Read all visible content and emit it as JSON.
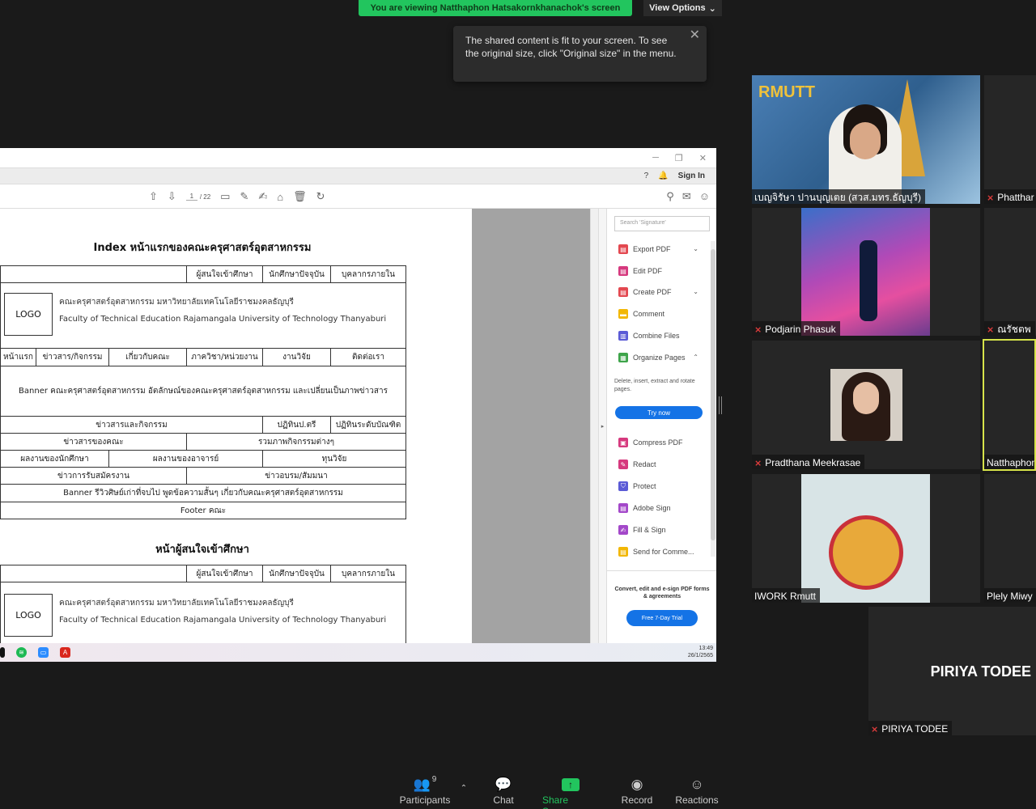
{
  "banner": {
    "viewing_text": "You are viewing Natthaphon Hatsakornkhanachok's screen",
    "view_options": "View Options"
  },
  "tooltip": {
    "text": "The shared content is fit to your screen. To see the original size, click \"Original size\" in the menu."
  },
  "acrobat": {
    "sign_in": "Sign In",
    "page_current": "1",
    "page_total": "/ 22",
    "search_placeholder": "Search 'Signature'",
    "tools": [
      {
        "label": "Export PDF",
        "color": "#e34850",
        "icon": "export-pdf-icon",
        "chevron": "⌄"
      },
      {
        "label": "Edit PDF",
        "color": "#d6397e",
        "icon": "edit-pdf-icon",
        "chevron": ""
      },
      {
        "label": "Create PDF",
        "color": "#e34850",
        "icon": "create-pdf-icon",
        "chevron": "⌄"
      },
      {
        "label": "Comment",
        "color": "#f2b705",
        "icon": "comment-icon",
        "chevron": ""
      },
      {
        "label": "Combine Files",
        "color": "#5b5bd6",
        "icon": "combine-files-icon",
        "chevron": ""
      },
      {
        "label": "Organize Pages",
        "color": "#3ea44a",
        "icon": "organize-pages-icon",
        "chevron": "⌃"
      }
    ],
    "organize_note": "Delete, insert, extract and rotate pages.",
    "try_now": "Try now",
    "tools2": [
      {
        "label": "Compress PDF",
        "color": "#d6397e",
        "icon": "compress-pdf-icon"
      },
      {
        "label": "Redact",
        "color": "#d6397e",
        "icon": "redact-icon"
      },
      {
        "label": "Protect",
        "color": "#5b5bd6",
        "icon": "protect-icon"
      },
      {
        "label": "Adobe Sign",
        "color": "#a348c9",
        "icon": "adobe-sign-icon"
      },
      {
        "label": "Fill & Sign",
        "color": "#a348c9",
        "icon": "fill-sign-icon"
      },
      {
        "label": "Send for Comme...",
        "color": "#f2b705",
        "icon": "send-comment-icon"
      }
    ],
    "promo_text": "Convert, edit and e-sign PDF forms & agreements",
    "free_trial": "Free 7-Day Trial"
  },
  "doc": {
    "heading1": "Index หน้าแรกของคณะครุศาสตร์อุตสาหกรรม",
    "top_links": [
      "ผู้สนใจเข้าศึกษา",
      "นักศึกษาปัจจุบัน",
      "บุคลากรภายใน"
    ],
    "logo": "LOGO",
    "faculty_th": "คณะครุศาสตร์อุตสาหกรรม มหาวิทยาลัยเทคโนโลยีราชมงคลธัญบุรี",
    "faculty_en": "Faculty of Technical Education Rajamangala University of Technology Thanyaburi",
    "nav": [
      "หน้าแรก",
      "ข่าวสาร/กิจกรรม",
      "เกี่ยวกับคณะ",
      "ภาควิชา/หน่วยงาน",
      "งานวิจัย",
      "ติดต่อเรา"
    ],
    "banner_text": "Banner คณะครุศาสตร์อุตสาหกรรม อัตลักษณ์ของคณะครุศาสตร์อุตสาหกรรม และเปลี่ยนเป็นภาพข่าวสาร",
    "row_news": [
      "ข่าวสารและกิจกรรม",
      "ปฏิทินป.ตรี",
      "ปฏิทินระดับบัณฑิต"
    ],
    "row_faculty": [
      "ข่าวสารของคณะ",
      "รวมภาพกิจกรรมต่างๆ"
    ],
    "row_works": [
      "ผลงานของนักศึกษา",
      "ผลงานของอาจารย์",
      "ทุนวิจัย"
    ],
    "row_jobs": [
      "ข่าวการรับสมัครงาน",
      "ข่าวอบรม/สัมมนา"
    ],
    "alumni_banner": "Banner รีวิวศิษย์เก่าที่จบไป พูดข้อความสั้นๆ เกี่ยวกับคณะครุศาสตร์อุตสาหกรรม",
    "footer": "Footer คณะ",
    "heading2": "หน้าผู้สนใจเข้าศึกษา"
  },
  "taskbar": {
    "time": "13:49",
    "date": "26/1/2565"
  },
  "participants": {
    "tile1": "เบญจิรัษา ปานบุญเตย (สวส.มทร.ธัญบุรี)",
    "tile2": "Phatthar",
    "tile3": "Podjarin Phasuk",
    "tile4": "ณรัชตพ",
    "tile5": "Pradthana Meekrasae",
    "tile6": "Natthaphon",
    "tile7": "IWORK Rmutt",
    "tile8": "Plely Miwy",
    "tile9_big": "PIRIYA TODEE",
    "tile9": "PIRIYA TODEE",
    "logo_text": "RMUTT"
  },
  "controls": {
    "participants": "Participants",
    "participants_count": "9",
    "chat": "Chat",
    "share": "Share Screen",
    "record": "Record",
    "reactions": "Reactions"
  }
}
